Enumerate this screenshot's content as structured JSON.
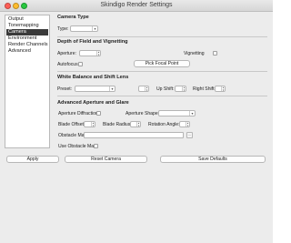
{
  "window": {
    "title": "Skindigo Render Settings"
  },
  "sidebar": {
    "items": [
      {
        "label": "Output",
        "selected": false
      },
      {
        "label": "Tonemapping",
        "selected": false
      },
      {
        "label": "Camera",
        "selected": true
      },
      {
        "label": "Environment",
        "selected": false
      },
      {
        "label": "Render Channels",
        "selected": false
      },
      {
        "label": "Advanced",
        "selected": false
      }
    ]
  },
  "camera_type": {
    "title": "Camera Type",
    "type_label": "Type:",
    "type_value": ""
  },
  "dof": {
    "title": "Depth of Field and Vignetting",
    "aperture_label": "Aperture:",
    "aperture_value": "",
    "vignetting_label": "Vignetting",
    "autofocus_label": "Autofocus",
    "pick_focal_point_label": "Pick Focal Point"
  },
  "white_balance": {
    "title": "White Balance and Shift Lens",
    "preset_label": "Preset:",
    "preset_value": "",
    "up_shift_label": "Up Shift:",
    "up_shift_value": "",
    "right_shift_label": "Right Shift:",
    "right_shift_value": ""
  },
  "aperture_glare": {
    "title": "Advanced Aperture and Glare",
    "aperture_diffraction_label": "Aperture Diffraction",
    "aperture_shape_label": "Aperture Shape:",
    "aperture_shape_value": "",
    "blade_offset_label": "Blade Offset:",
    "blade_offset_value": "",
    "blade_radius_label": "Blade Radius:",
    "blade_radius_value": "",
    "rotation_angle_label": "Rotation Angle:",
    "rotation_angle_value": "",
    "obstacle_map_label": "Obstacle Map:",
    "obstacle_map_value": "",
    "browse_label": "...",
    "use_obstacle_map_label": "Use Obstacle Map"
  },
  "buttons": {
    "apply": "Apply",
    "reset_camera": "Reset Camera",
    "save_defaults": "Save Defaults"
  },
  "colors": {
    "window_bg": "#ececec",
    "selected_item_bg": "#3a3a3a",
    "selected_item_text": "#ffffff"
  }
}
